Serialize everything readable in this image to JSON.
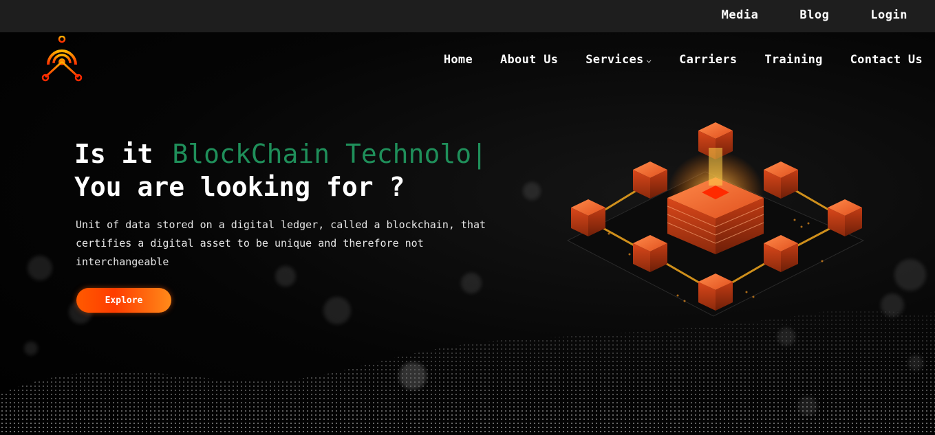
{
  "topbar": {
    "links": [
      "Media",
      "Blog",
      "Login"
    ]
  },
  "nav": {
    "items": [
      "Home",
      "About Us",
      "Services",
      "Carriers",
      "Training",
      "Contact Us"
    ]
  },
  "hero": {
    "title_prefix": "Is it",
    "title_typed": "BlockChain Technolo",
    "cursor": "|",
    "title_line2": "You are looking for ?",
    "description": "Unit of data stored on a digital ledger, called a blockchain, that certifies a digital asset to be unique and therefore not interchangeable",
    "cta_label": "Explore"
  },
  "colors": {
    "accent_green": "#1f8f5a",
    "brand_orange": "#ff5a00",
    "topbar_bg": "#1e1e1e"
  },
  "icons": {
    "logo": "blockchain-node-logo-icon",
    "services_dropdown": "chevron-down-icon"
  }
}
